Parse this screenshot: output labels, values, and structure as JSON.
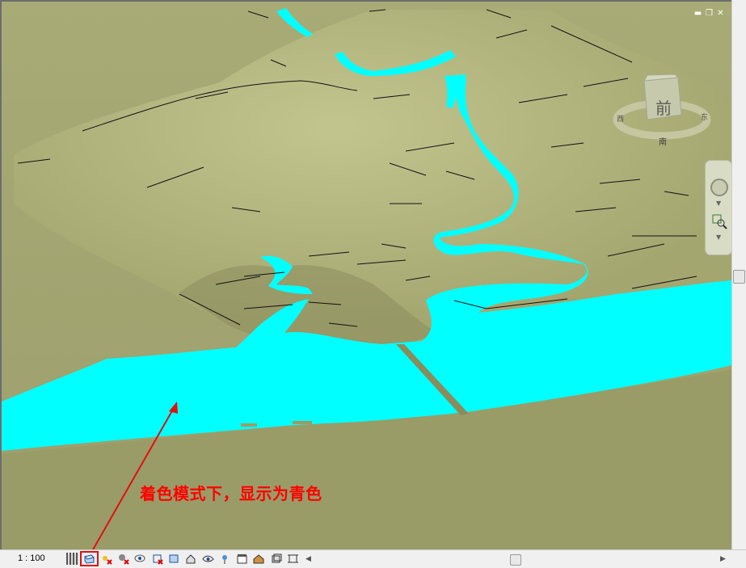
{
  "view": {
    "cube_face_label": "前",
    "cube_south_label": "南"
  },
  "window_controls": {
    "minimize": "▬",
    "restore": "❐",
    "close": "✕"
  },
  "annotation": {
    "text": "着色模式下，显示为青色"
  },
  "status_bar": {
    "scale": "1 : 100",
    "icons": [
      "detail-level-icon",
      "visual-style-icon",
      "sun-path-icon",
      "shadows-icon",
      "render-icon",
      "crop-view-icon",
      "show-crop-icon",
      "unlock-3d-icon",
      "temporary-hide-icon",
      "reveal-hidden-icon",
      "worksharing-icon",
      "design-options-icon",
      "analytical-model-icon",
      "constraints-icon",
      "highlight-displacement-icon"
    ]
  },
  "colors": {
    "terrain": "#a6a872",
    "terrain_light": "#b8bb84",
    "water": "#00ffff",
    "annotation": "#ff0000"
  }
}
